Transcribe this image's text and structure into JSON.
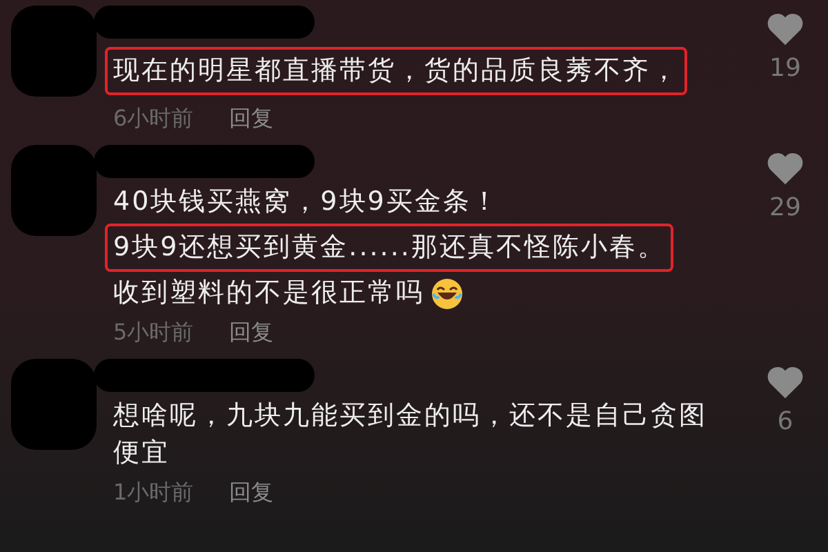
{
  "comments": [
    {
      "lines": [
        {
          "text": "现在的明星都直播带货，货的品质良莠不齐，",
          "highlighted": true,
          "kind": "text"
        }
      ],
      "time": "6小时前",
      "reply": "回复",
      "likes": "19"
    },
    {
      "lines": [
        {
          "text": "40块钱买燕窝，9块9买金条！",
          "highlighted": false,
          "kind": "text"
        },
        {
          "text": "9块9还想买到黄金......那还真不怪陈小春。",
          "highlighted": true,
          "kind": "text"
        },
        {
          "text": "收到塑料的不是很正常吗",
          "highlighted": false,
          "kind": "text_with_emoji"
        }
      ],
      "time": "5小时前",
      "reply": "回复",
      "likes": "29"
    },
    {
      "lines": [
        {
          "text": "想啥呢，九块九能买到金的吗，还不是自己贪图便宜",
          "highlighted": false,
          "kind": "text"
        }
      ],
      "time": "1小时前",
      "reply": "回复",
      "likes": "6"
    }
  ]
}
